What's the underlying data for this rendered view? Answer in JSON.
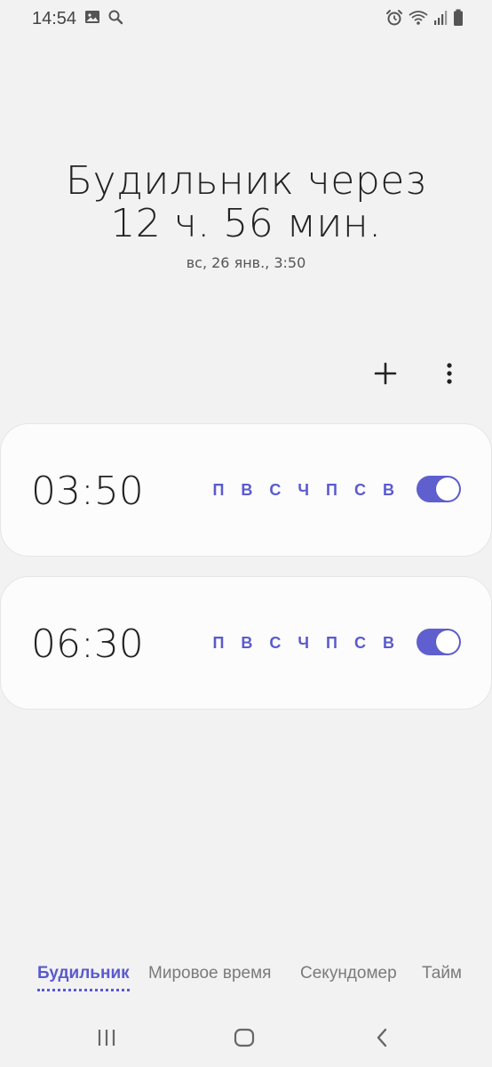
{
  "status_bar": {
    "time": "14:54",
    "left_icons": [
      "image-icon",
      "search-icon"
    ],
    "right_icons": [
      "alarm-icon",
      "wifi-icon",
      "signal-icon",
      "battery-icon"
    ]
  },
  "header": {
    "title_line1": "Будильник через",
    "title_line2": "12 ч. 56 мин.",
    "subtitle": "вс, 26 янв., 3:50"
  },
  "toolbar": {
    "add_icon": "plus-icon",
    "more_icon": "more-vertical-icon"
  },
  "alarms": [
    {
      "time": "03:50",
      "days": "П В С Ч П С В",
      "enabled": true
    },
    {
      "time": "06:30",
      "days": "П В С Ч П С В",
      "enabled": true
    }
  ],
  "tabs": [
    {
      "label": "Будильник",
      "active": true
    },
    {
      "label": "Мировое время",
      "active": false
    },
    {
      "label": "Секундомер",
      "active": false
    },
    {
      "label": "Тайм",
      "active": false
    }
  ],
  "nav_bar": {
    "buttons": [
      "recents-icon",
      "home-icon",
      "back-icon"
    ]
  },
  "colors": {
    "background": "#f2f2f2",
    "accent": "#5a5ad0",
    "card": "#fcfcfc",
    "text_primary": "#222222",
    "text_secondary": "#7a7a7a"
  }
}
